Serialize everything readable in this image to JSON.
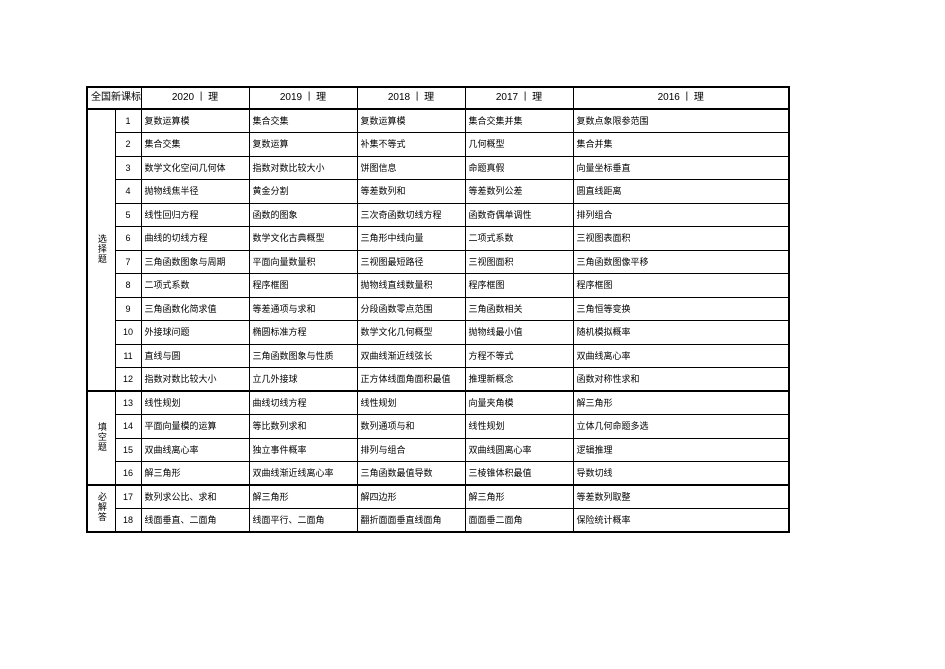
{
  "table": {
    "corner_label": "全国新课标",
    "year_separator": "丨",
    "columns": [
      {
        "year": "2020",
        "track": "理"
      },
      {
        "year": "2019",
        "track": "理"
      },
      {
        "year": "2018",
        "track": "理"
      },
      {
        "year": "2017",
        "track": "理"
      },
      {
        "year": "2016",
        "track": "理"
      }
    ],
    "sections": [
      {
        "label": "选择题",
        "rows": [
          {
            "num": "1",
            "cells": [
              "复数运算模",
              "集合交集",
              "复数运算模",
              "集合交集并集",
              "复数点象限参范围"
            ]
          },
          {
            "num": "2",
            "cells": [
              "集合交集",
              "复数运算",
              "补集不等式",
              "几何概型",
              "集合并集"
            ]
          },
          {
            "num": "3",
            "cells": [
              "数学文化空间几何体",
              "指数对数比较大小",
              "饼图信息",
              "命题真假",
              "向量坐标垂直"
            ]
          },
          {
            "num": "4",
            "cells": [
              "抛物线焦半径",
              "黄金分割",
              "等差数列和",
              "等差数列公差",
              "圆直线距离"
            ]
          },
          {
            "num": "5",
            "cells": [
              "线性回归方程",
              "函数的图象",
              "三次奇函数切线方程",
              "函数奇偶单调性",
              "排列组合"
            ]
          },
          {
            "num": "6",
            "cells": [
              "曲线的切线方程",
              "数学文化古典概型",
              "三角形中线向量",
              "二项式系数",
              "三视图表面积"
            ]
          },
          {
            "num": "7",
            "cells": [
              "三角函数图象与周期",
              "平面向量数量积",
              "三视图最短路径",
              "三视图面积",
              "三角函数图像平移"
            ]
          },
          {
            "num": "8",
            "cells": [
              "二项式系数",
              "程序框图",
              "抛物线直线数量积",
              "程序框图",
              "程序框图"
            ]
          },
          {
            "num": "9",
            "cells": [
              "三角函数化简求值",
              "等差通项与求和",
              "分段函数零点范围",
              "三角函数相关",
              "三角恒等变换"
            ]
          },
          {
            "num": "10",
            "cells": [
              "外接球问题",
              "椭圆标准方程",
              "数学文化几何概型",
              "抛物线最小值",
              "随机模拟概率"
            ]
          },
          {
            "num": "11",
            "cells": [
              "直线与圆",
              "三角函数图象与性质",
              "双曲线渐近线弦长",
              "方程不等式",
              "双曲线离心率"
            ]
          },
          {
            "num": "12",
            "cells": [
              "指数对数比较大小",
              "立几外接球",
              "正方体线面角面积最值",
              "推理新概念",
              "函数对称性求和"
            ]
          }
        ]
      },
      {
        "label": "填空题",
        "rows": [
          {
            "num": "13",
            "cells": [
              "线性规划",
              "曲线切线方程",
              "线性规划",
              "向量夹角模",
              "解三角形"
            ]
          },
          {
            "num": "14",
            "cells": [
              "平面向量模的运算",
              "等比数列求和",
              "数列通项与和",
              "线性规划",
              "立体几何命题多选"
            ]
          },
          {
            "num": "15",
            "cells": [
              "双曲线离心率",
              "独立事件概率",
              "排列与组合",
              "双曲线圆离心率",
              "逻辑推理"
            ]
          },
          {
            "num": "16",
            "cells": [
              "解三角形",
              "双曲线渐近线离心率",
              "三角函数最值导数",
              "三棱锥体积最值",
              "导数切线"
            ]
          }
        ]
      },
      {
        "label": "必解答",
        "rows": [
          {
            "num": "17",
            "cells": [
              "数列求公比、求和",
              "解三角形",
              "解四边形",
              "解三角形",
              "等差数列取整"
            ]
          },
          {
            "num": "18",
            "cells": [
              "线面垂直、二面角",
              "线面平行、二面角",
              "翻折面面垂直线面角",
              "面面垂二面角",
              "保险统计概率"
            ]
          }
        ]
      }
    ]
  }
}
